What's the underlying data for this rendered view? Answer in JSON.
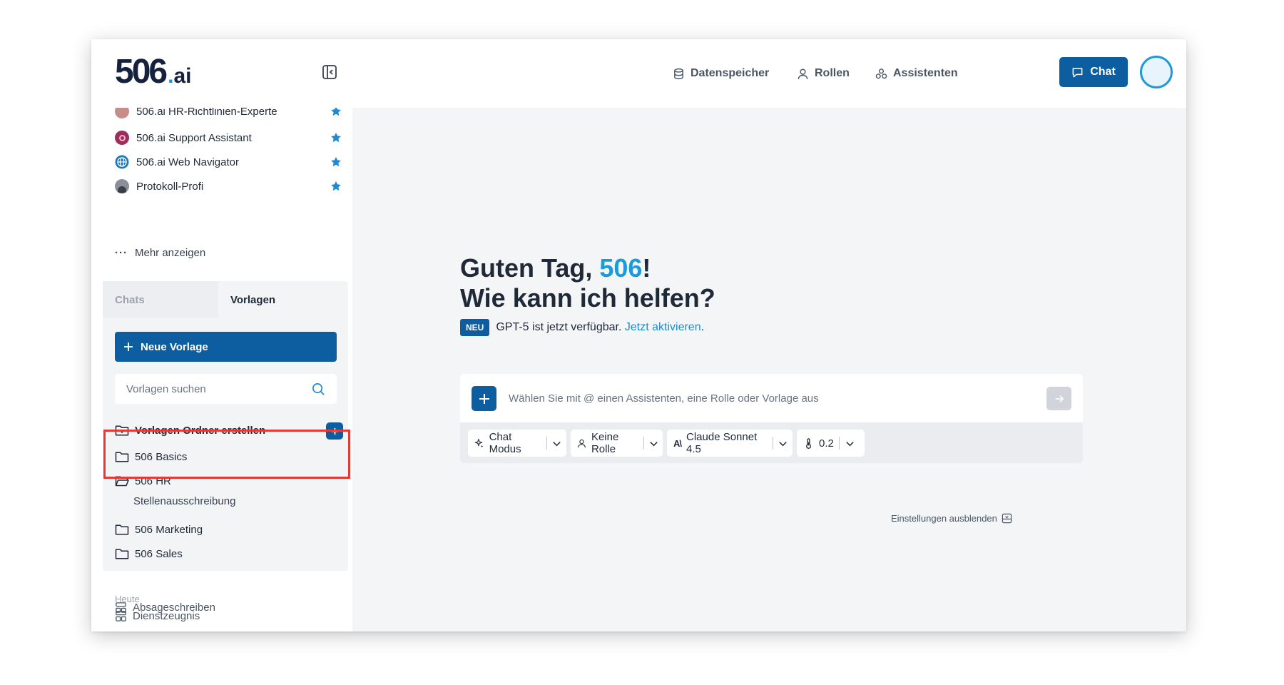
{
  "header": {
    "logo_number": "506",
    "logo_suffix": "ai",
    "nav": [
      {
        "label": "Datenspeicher",
        "icon": "database-icon"
      },
      {
        "label": "Rollen",
        "icon": "user-icon"
      },
      {
        "label": "Assistenten",
        "icon": "assistants-icon"
      }
    ],
    "chat_button": "Chat"
  },
  "sidebar": {
    "assistants": [
      {
        "label": "506.ai HR-Richtlinien-Experte",
        "starred": true
      },
      {
        "label": "506.ai Support Assistant",
        "starred": true
      },
      {
        "label": "506.ai Web Navigator",
        "starred": true
      },
      {
        "label": "Protokoll-Profi",
        "starred": true
      }
    ],
    "more_label": "Mehr anzeigen",
    "tabs": [
      "Chats",
      "Vorlagen"
    ],
    "active_tab": "Vorlagen",
    "new_template_button": "Neue Vorlage",
    "search_placeholder": "Vorlagen suchen",
    "create_folder_label": "Vorlagen Ordner erstellen",
    "folders": [
      {
        "label": "506 Basics"
      },
      {
        "label": "506 HR",
        "items": [
          "Stellenausschreibung"
        ]
      },
      {
        "label": "506 Marketing"
      },
      {
        "label": "506 Sales"
      }
    ],
    "history_section": "Heute",
    "history": [
      "Dienstzeugnis",
      "Absageschreiben"
    ]
  },
  "main": {
    "greeting_prefix": "Guten Tag, ",
    "greeting_name": "506",
    "greeting_suffix": "!",
    "greeting_line2": "Wie kann ich helfen?",
    "badge": "NEU",
    "news_text": "GPT-5 ist jetzt verfügbar.",
    "news_link": "Jetzt aktivieren",
    "news_end": ".",
    "prompt_placeholder": "Wählen Sie mit @ einen Assistenten, eine Rolle oder Vorlage aus",
    "chips": {
      "mode": "Chat Modus",
      "role": "Keine Rolle",
      "model": "Claude Sonnet 4.5",
      "temperature": "0.2"
    },
    "hide_settings": "Einstellungen ausblenden"
  },
  "colors": {
    "brand": "#0c5ea1",
    "accent": "#1f9ad8",
    "highlight": "#e53935"
  }
}
